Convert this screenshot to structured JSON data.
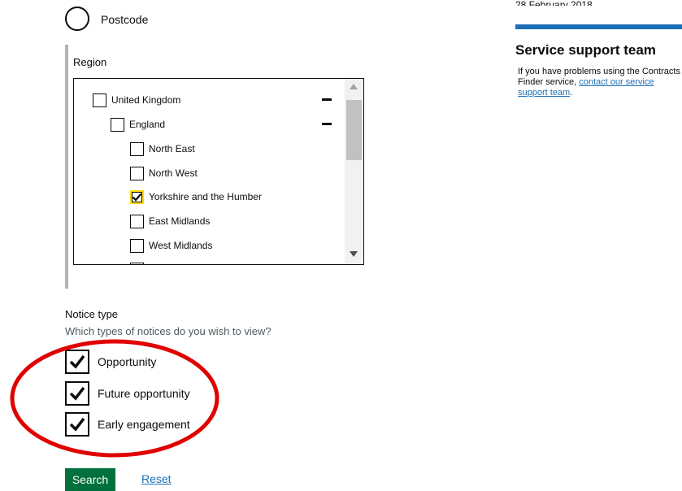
{
  "postcode": {
    "label": "Postcode"
  },
  "region": {
    "label": "Region",
    "items": [
      {
        "label": "United Kingdom",
        "checked": false,
        "expanded": true
      },
      {
        "label": "England",
        "checked": false,
        "expanded": true
      },
      {
        "label": "North East",
        "checked": false
      },
      {
        "label": "North West",
        "checked": false
      },
      {
        "label": "Yorkshire and the Humber",
        "checked": true
      },
      {
        "label": "East Midlands",
        "checked": false
      },
      {
        "label": "West Midlands",
        "checked": false
      }
    ]
  },
  "notice_type": {
    "title": "Notice type",
    "hint": "Which types of notices do you wish to view?",
    "options": [
      {
        "label": "Opportunity",
        "checked": true
      },
      {
        "label": "Future opportunity",
        "checked": true
      },
      {
        "label": "Early engagement",
        "checked": true
      }
    ]
  },
  "actions": {
    "search_label": "Search",
    "reset_label": "Reset"
  },
  "sidebar": {
    "clipped_date": "28 February 2018.",
    "support_title": "Service support team",
    "support_text": "If you have problems using the Contracts Finder service, ",
    "support_link": "contact our service support team",
    "support_suffix": "."
  },
  "colors": {
    "search_button": "#00703c",
    "link": "#1d70b8",
    "focus": "#ffdd00",
    "annotation": "#e00000"
  }
}
